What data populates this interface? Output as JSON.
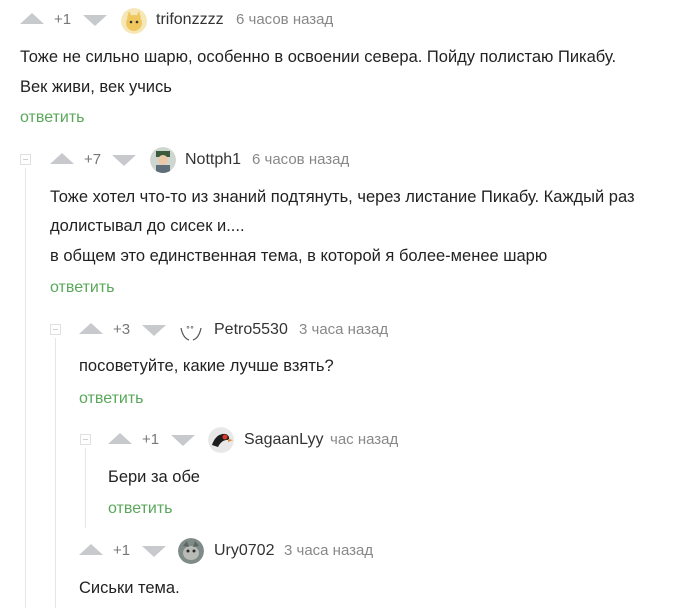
{
  "comments": [
    {
      "score": "+1",
      "username": "trifonzzzz",
      "time": "6 часов назад",
      "avatar_icon": "cat-face-avatar",
      "lines": [
        "Тоже не сильно шарю, особенно в освоении севера. Пойду полистаю Пикабу.",
        "Век живи, век учись"
      ],
      "reply_label": "ответить"
    },
    {
      "score": "+7",
      "username": "Nottph1",
      "time": "6 часов назад",
      "avatar_icon": "person-with-hat-avatar",
      "lines": [
        "Тоже хотел что-то из знаний подтянуть, через листание Пикабу. Каждый раз",
        "долистывал до сисек и....",
        "в общем это единственная тема, в которой я более-менее шарю"
      ],
      "reply_label": "ответить"
    },
    {
      "score": "+3",
      "username": "Petro5530",
      "time": "3 часа назад",
      "avatar_icon": "face-sketch-avatar",
      "lines": [
        "посоветуйте, какие лучше взять?"
      ],
      "reply_label": "ответить"
    },
    {
      "score": "+1",
      "username": "SagaanLyy",
      "time": "час назад",
      "avatar_icon": "bird-avatar",
      "lines": [
        "Бери за обе"
      ],
      "reply_label": "ответить"
    },
    {
      "score": "+1",
      "username": "Ury0702",
      "time": "3 часа назад",
      "avatar_icon": "animal-photo-avatar",
      "lines": [
        "Сиськи тема."
      ],
      "reply_label": ""
    }
  ],
  "colors": {
    "reply_link": "#59a85a",
    "rating_arrow": "#c7c9cc",
    "branch_line": "#e6e6e6"
  }
}
